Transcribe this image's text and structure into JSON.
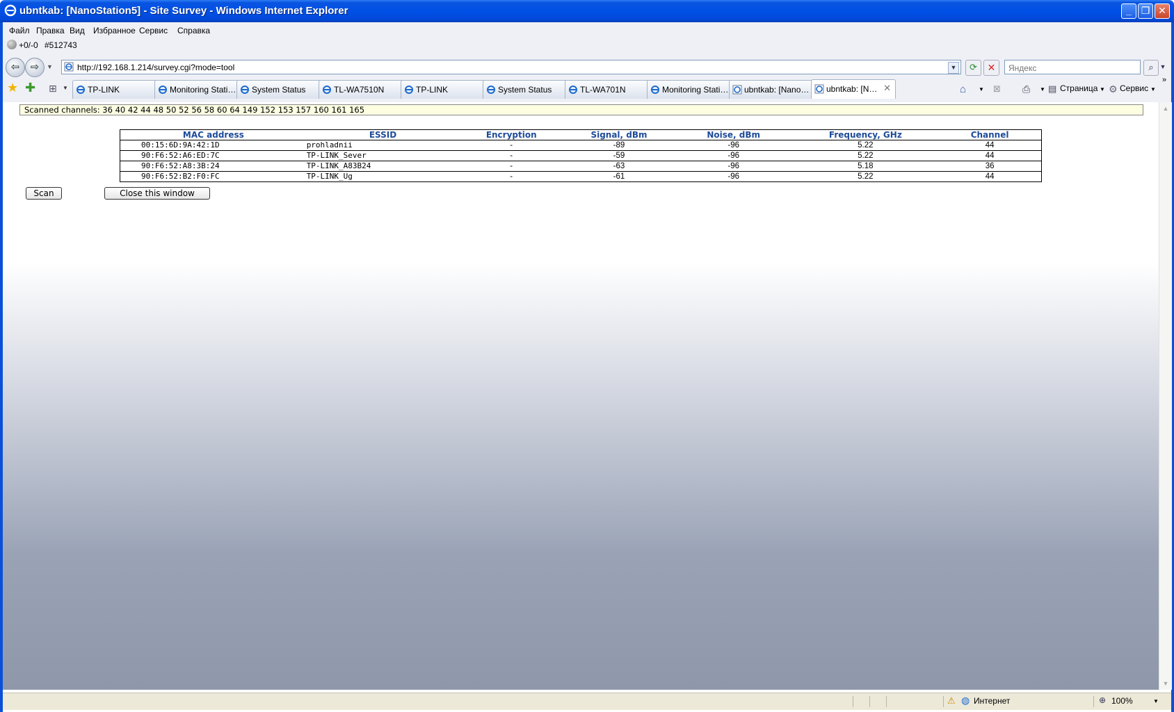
{
  "window": {
    "title": "ubntkab: [NanoStation5] - Site Survey - Windows Internet Explorer"
  },
  "menu": [
    "Файл",
    "Правка",
    "Вид",
    "Избранное",
    "Сервис",
    "Справка"
  ],
  "links_bar": {
    "counter": "+0/-0",
    "id": "#512743"
  },
  "address": {
    "url": "http://192.168.1.214/survey.cgi?mode=tool"
  },
  "search": {
    "placeholder": "Яндекс"
  },
  "tabs": [
    {
      "label": "TP-LINK"
    },
    {
      "label": "Monitoring Statio..."
    },
    {
      "label": "System Status"
    },
    {
      "label": "TL-WA7510N"
    },
    {
      "label": "TP-LINK"
    },
    {
      "label": "System Status"
    },
    {
      "label": "TL-WA701N"
    },
    {
      "label": "Monitoring Statio..."
    },
    {
      "label": "ubntkab: [NanoS..."
    },
    {
      "label": "ubntkab: [Na..."
    }
  ],
  "command_bar": {
    "page": "Страница",
    "tools": "Сервис"
  },
  "scanned_channels": "Scanned channels: 36 40 42 44 48 50 52 56 58 60 64 149 152 153 157 160 161 165",
  "table": {
    "headers": [
      "MAC address",
      "ESSID",
      "Encryption",
      "Signal, dBm",
      "Noise, dBm",
      "Frequency, GHz",
      "Channel"
    ],
    "rows": [
      [
        "00:15:6D:9A:42:1D",
        "prohladnii",
        "-",
        "-89",
        "-96",
        "5.22",
        "44"
      ],
      [
        "90:F6:52:A6:ED:7C",
        "TP-LINK_Sever",
        "-",
        "-59",
        "-96",
        "5.22",
        "44"
      ],
      [
        "90:F6:52:A8:3B:24",
        "TP-LINK_A83B24",
        "-",
        "-63",
        "-96",
        "5.18",
        "36"
      ],
      [
        "90:F6:52:B2:F0:FC",
        "TP-LINK_Ug",
        "-",
        "-61",
        "-96",
        "5.22",
        "44"
      ]
    ]
  },
  "buttons": {
    "scan": "Scan",
    "close": "Close this window"
  },
  "status": {
    "zone": "Интернет",
    "zoom": "100%"
  },
  "colors": {
    "title_bar": "#0050e6",
    "table_header": "#1e4b9a",
    "scanned_bg": "#fdfde2"
  }
}
